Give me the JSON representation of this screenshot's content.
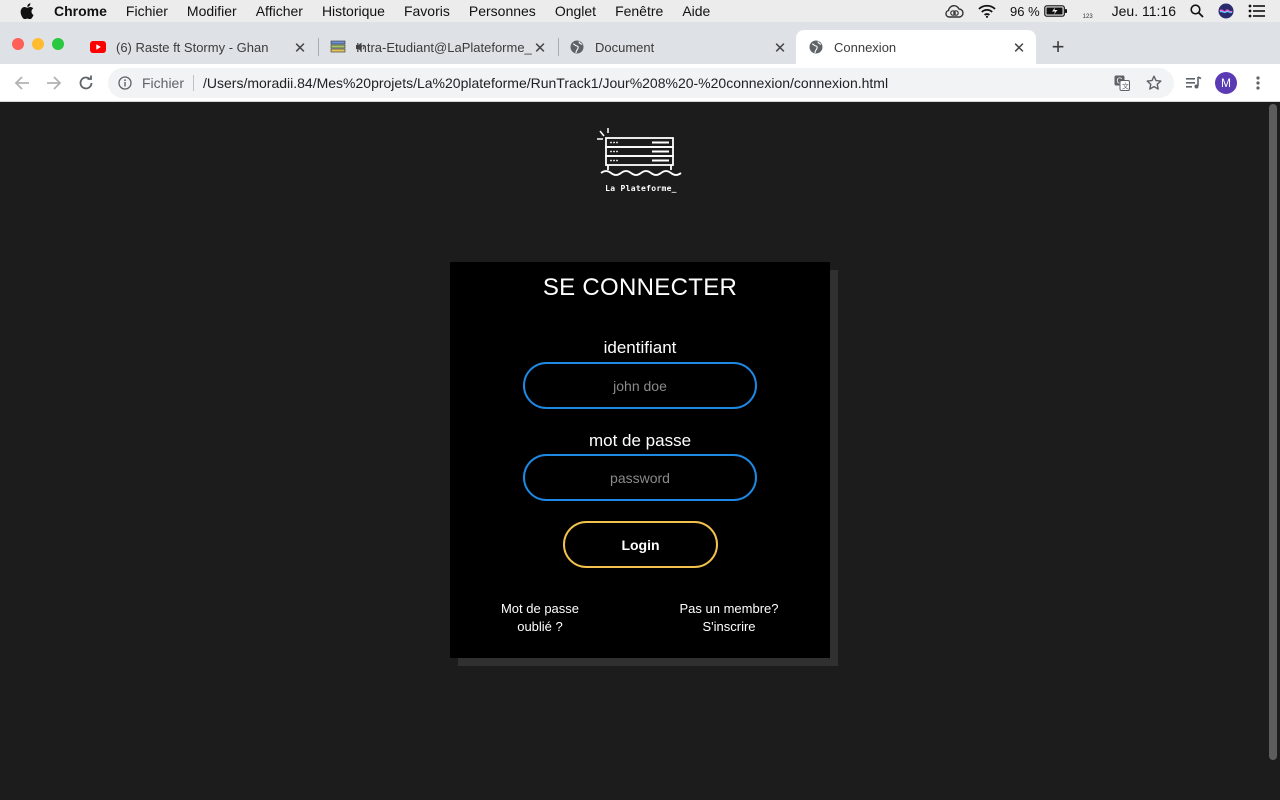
{
  "menubar": {
    "app_name": "Chrome",
    "items": [
      "Fichier",
      "Modifier",
      "Afficher",
      "Historique",
      "Favoris",
      "Personnes",
      "Onglet",
      "Fenêtre",
      "Aide"
    ],
    "battery": "96 %",
    "keyboard_layout_number": "123",
    "clock": "Jeu. 11:16"
  },
  "tabs": [
    {
      "title": "(6) Raste ft Stormy - Ghan",
      "favicon": "youtube-icon",
      "audio": true
    },
    {
      "title": "Intra-Etudiant@LaPlateforme_",
      "favicon": "laplateforme-icon"
    },
    {
      "title": "Document",
      "favicon": "globe-icon"
    },
    {
      "title": "Connexion",
      "favicon": "globe-icon",
      "active": true
    }
  ],
  "toolbar": {
    "scheme_label": "Fichier",
    "url": "/Users/moradii.84/Mes%20projets/La%20plateforme/RunTrack1/Jour%208%20-%20connexion/connexion.html",
    "profile_initial": "M"
  },
  "page": {
    "logo_text": "La Plateforme_",
    "form": {
      "title": "SE CONNECTER",
      "username_label": "identifiant",
      "username_placeholder": "john doe",
      "password_label": "mot de passe",
      "password_placeholder": "password",
      "login_label": "Login",
      "forgot_line1": "Mot de passe",
      "forgot_line2": "oublié ?",
      "signup_line1": "Pas un membre?",
      "signup_line2": "S'inscrire"
    }
  },
  "colors": {
    "page_background": "#1c1c1c",
    "card_background": "#000000",
    "input_border": "#1e88e5",
    "button_border": "#f2c14e"
  }
}
